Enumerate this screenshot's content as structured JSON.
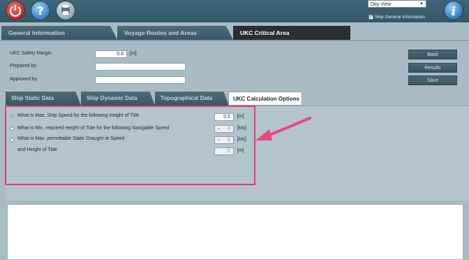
{
  "topbar": {
    "view_select": "Day View",
    "skip_label": "Skip General Information",
    "skip_checked": true,
    "icons": [
      "power-icon",
      "help-icon",
      "print-icon",
      "info-icon"
    ]
  },
  "main_tabs": [
    "General Information",
    "Voyage Routes and Areas",
    "UKC Critical Area"
  ],
  "form": {
    "ukc_label": "UKC Safety Margin",
    "ukc_value": "0.8",
    "ukc_unit": "[m]",
    "prepared_label": "Prepared by",
    "prepared_value": "",
    "approved_label": "Approved by",
    "approved_value": ""
  },
  "side_buttons": {
    "back": "Back",
    "results": "Results",
    "save": "Save"
  },
  "sub_tabs": [
    "Ship Static Data",
    "Ship Dynamic Data",
    "Topographical Data",
    "UKC Calculation Options"
  ],
  "options": {
    "opt1_label": "What is Max. Ship Speed for the following Height of Tide",
    "opt1_value": "0.5",
    "opt1_unit": "[m]",
    "opt2_label": "What is Min. required Height of Tide for the following Navigable Speed",
    "opt2_value": "0",
    "opt2_unit": "[kts]",
    "opt3_label": "What is Max. permittable Static Draught at Speed",
    "opt3_value": "0",
    "opt3_unit": "[kts]",
    "opt3b_label": "and Height of Tide",
    "opt3b_value": "0",
    "opt3b_unit": "[m]"
  },
  "colors": {
    "highlight": "#e0407a",
    "arrow": "#e8487e",
    "header": "#3a5f70"
  }
}
